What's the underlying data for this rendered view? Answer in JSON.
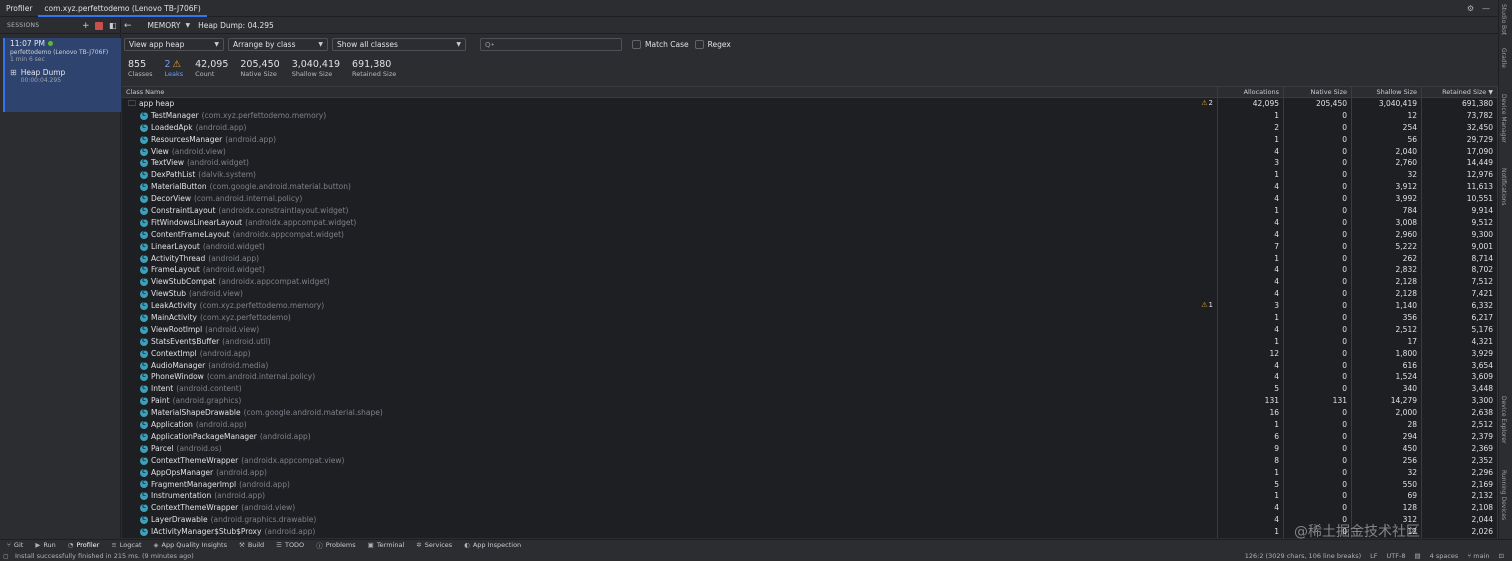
{
  "topbar": {
    "tool_window": "Profiler",
    "tab": "com.xyz.perfettodemo (Lenovo TB-J706F)"
  },
  "sessions": {
    "header": "SESSIONS",
    "session": {
      "time": "11:07 PM",
      "device": "perfettodemo (Lenovo TB-J706F)",
      "duration": "1 min 6 sec",
      "artifact_title": "Heap Dump",
      "artifact_time": "00:00:04.295"
    }
  },
  "memory": {
    "label": "MEMORY",
    "heap_dump": "Heap Dump: 04.295"
  },
  "toolbar": {
    "heap": "View app heap",
    "arrange": "Arrange by class",
    "filter": "Show all classes",
    "search_placeholder": "Q•",
    "match_case": "Match Case",
    "regex": "Regex"
  },
  "stats": [
    {
      "value": "855",
      "label": "Classes"
    },
    {
      "value": "2",
      "label": "Leaks"
    },
    {
      "value": "42,095",
      "label": "Count"
    },
    {
      "value": "205,450",
      "label": "Native Size"
    },
    {
      "value": "3,040,419",
      "label": "Shallow Size"
    },
    {
      "value": "691,380",
      "label": "Retained Size"
    }
  ],
  "table": {
    "headers": [
      "Class Name",
      "Allocations",
      "Native Size",
      "Shallow Size",
      "Retained Size"
    ],
    "root": {
      "name": "app heap",
      "warn": "2",
      "alloc": "42,095",
      "native": "205,450",
      "shallow": "3,040,419",
      "retained": "691,380"
    },
    "rows": [
      {
        "name": "TestManager",
        "pkg": "(com.xyz.perfettodemo.memory)",
        "alloc": "1",
        "native": "0",
        "shallow": "12",
        "retained": "73,782",
        "warn": ""
      },
      {
        "name": "LoadedApk",
        "pkg": "(android.app)",
        "alloc": "2",
        "native": "0",
        "shallow": "254",
        "retained": "32,450",
        "warn": ""
      },
      {
        "name": "ResourcesManager",
        "pkg": "(android.app)",
        "alloc": "1",
        "native": "0",
        "shallow": "56",
        "retained": "29,729",
        "warn": ""
      },
      {
        "name": "View",
        "pkg": "(android.view)",
        "alloc": "4",
        "native": "0",
        "shallow": "2,040",
        "retained": "17,090",
        "warn": ""
      },
      {
        "name": "TextView",
        "pkg": "(android.widget)",
        "alloc": "3",
        "native": "0",
        "shallow": "2,760",
        "retained": "14,449",
        "warn": ""
      },
      {
        "name": "DexPathList",
        "pkg": "(dalvik.system)",
        "alloc": "1",
        "native": "0",
        "shallow": "32",
        "retained": "12,976",
        "warn": ""
      },
      {
        "name": "MaterialButton",
        "pkg": "(com.google.android.material.button)",
        "alloc": "4",
        "native": "0",
        "shallow": "3,912",
        "retained": "11,613",
        "warn": ""
      },
      {
        "name": "DecorView",
        "pkg": "(com.android.internal.policy)",
        "alloc": "4",
        "native": "0",
        "shallow": "3,992",
        "retained": "10,551",
        "warn": ""
      },
      {
        "name": "ConstraintLayout",
        "pkg": "(androidx.constraintlayout.widget)",
        "alloc": "1",
        "native": "0",
        "shallow": "784",
        "retained": "9,914",
        "warn": ""
      },
      {
        "name": "FitWindowsLinearLayout",
        "pkg": "(androidx.appcompat.widget)",
        "alloc": "4",
        "native": "0",
        "shallow": "3,008",
        "retained": "9,512",
        "warn": ""
      },
      {
        "name": "ContentFrameLayout",
        "pkg": "(androidx.appcompat.widget)",
        "alloc": "4",
        "native": "0",
        "shallow": "2,960",
        "retained": "9,300",
        "warn": ""
      },
      {
        "name": "LinearLayout",
        "pkg": "(android.widget)",
        "alloc": "7",
        "native": "0",
        "shallow": "5,222",
        "retained": "9,001",
        "warn": ""
      },
      {
        "name": "ActivityThread",
        "pkg": "(android.app)",
        "alloc": "1",
        "native": "0",
        "shallow": "262",
        "retained": "8,714",
        "warn": ""
      },
      {
        "name": "FrameLayout",
        "pkg": "(android.widget)",
        "alloc": "4",
        "native": "0",
        "shallow": "2,832",
        "retained": "8,702",
        "warn": ""
      },
      {
        "name": "ViewStubCompat",
        "pkg": "(androidx.appcompat.widget)",
        "alloc": "4",
        "native": "0",
        "shallow": "2,128",
        "retained": "7,512",
        "warn": ""
      },
      {
        "name": "ViewStub",
        "pkg": "(android.view)",
        "alloc": "4",
        "native": "0",
        "shallow": "2,128",
        "retained": "7,421",
        "warn": ""
      },
      {
        "name": "LeakActivity",
        "pkg": "(com.xyz.perfettodemo.memory)",
        "alloc": "3",
        "native": "0",
        "shallow": "1,140",
        "retained": "6,332",
        "warn": "1"
      },
      {
        "name": "MainActivity",
        "pkg": "(com.xyz.perfettodemo)",
        "alloc": "1",
        "native": "0",
        "shallow": "356",
        "retained": "6,217",
        "warn": ""
      },
      {
        "name": "ViewRootImpl",
        "pkg": "(android.view)",
        "alloc": "4",
        "native": "0",
        "shallow": "2,512",
        "retained": "5,176",
        "warn": ""
      },
      {
        "name": "StatsEvent$Buffer",
        "pkg": "(android.util)",
        "alloc": "1",
        "native": "0",
        "shallow": "17",
        "retained": "4,321",
        "warn": ""
      },
      {
        "name": "ContextImpl",
        "pkg": "(android.app)",
        "alloc": "12",
        "native": "0",
        "shallow": "1,800",
        "retained": "3,929",
        "warn": ""
      },
      {
        "name": "AudioManager",
        "pkg": "(android.media)",
        "alloc": "4",
        "native": "0",
        "shallow": "616",
        "retained": "3,654",
        "warn": ""
      },
      {
        "name": "PhoneWindow",
        "pkg": "(com.android.internal.policy)",
        "alloc": "4",
        "native": "0",
        "shallow": "1,524",
        "retained": "3,609",
        "warn": ""
      },
      {
        "name": "Intent",
        "pkg": "(android.content)",
        "alloc": "5",
        "native": "0",
        "shallow": "340",
        "retained": "3,448",
        "warn": ""
      },
      {
        "name": "Paint",
        "pkg": "(android.graphics)",
        "alloc": "131",
        "native": "131",
        "shallow": "14,279",
        "retained": "3,300",
        "warn": ""
      },
      {
        "name": "MaterialShapeDrawable",
        "pkg": "(com.google.android.material.shape)",
        "alloc": "16",
        "native": "0",
        "shallow": "2,000",
        "retained": "2,638",
        "warn": ""
      },
      {
        "name": "Application",
        "pkg": "(android.app)",
        "alloc": "1",
        "native": "0",
        "shallow": "28",
        "retained": "2,512",
        "warn": ""
      },
      {
        "name": "ApplicationPackageManager",
        "pkg": "(android.app)",
        "alloc": "6",
        "native": "0",
        "shallow": "294",
        "retained": "2,379",
        "warn": ""
      },
      {
        "name": "Parcel",
        "pkg": "(android.os)",
        "alloc": "9",
        "native": "0",
        "shallow": "450",
        "retained": "2,369",
        "warn": ""
      },
      {
        "name": "ContextThemeWrapper",
        "pkg": "(androidx.appcompat.view)",
        "alloc": "8",
        "native": "0",
        "shallow": "256",
        "retained": "2,352",
        "warn": ""
      },
      {
        "name": "AppOpsManager",
        "pkg": "(android.app)",
        "alloc": "1",
        "native": "0",
        "shallow": "32",
        "retained": "2,296",
        "warn": ""
      },
      {
        "name": "FragmentManagerImpl",
        "pkg": "(android.app)",
        "alloc": "5",
        "native": "0",
        "shallow": "550",
        "retained": "2,169",
        "warn": ""
      },
      {
        "name": "Instrumentation",
        "pkg": "(android.app)",
        "alloc": "1",
        "native": "0",
        "shallow": "69",
        "retained": "2,132",
        "warn": ""
      },
      {
        "name": "ContextThemeWrapper",
        "pkg": "(android.view)",
        "alloc": "4",
        "native": "0",
        "shallow": "128",
        "retained": "2,108",
        "warn": ""
      },
      {
        "name": "LayerDrawable",
        "pkg": "(android.graphics.drawable)",
        "alloc": "4",
        "native": "0",
        "shallow": "312",
        "retained": "2,044",
        "warn": ""
      },
      {
        "name": "IActivityManager$Stub$Proxy",
        "pkg": "(android.app)",
        "alloc": "1",
        "native": "0",
        "shallow": "12",
        "retained": "2,026",
        "warn": ""
      }
    ]
  },
  "bottom_tabs": [
    "Git",
    "Run",
    "Profiler",
    "Logcat",
    "App Quality Insights",
    "Build",
    "TODO",
    "Problems",
    "Terminal",
    "Services",
    "App Inspection"
  ],
  "status": {
    "message": "Install successfully finished in 215 ms. (9 minutes ago)",
    "position": "126:2 (3029 chars, 106 line breaks)",
    "line_sep": "LF",
    "encoding": "UTF-8",
    "indent": "4 spaces",
    "branch": "main"
  },
  "right_strip": [
    "Studio Bot",
    "Gradle",
    "Device Manager",
    "Notifications",
    "Device Explorer",
    "Running Devices"
  ],
  "watermark": "@稀土掘金技术社区",
  "colors": {
    "accent": "#3574f0",
    "warning": "#e3a33a",
    "class_icon": "#3d9fb8",
    "status_dot": "#5fb832"
  }
}
